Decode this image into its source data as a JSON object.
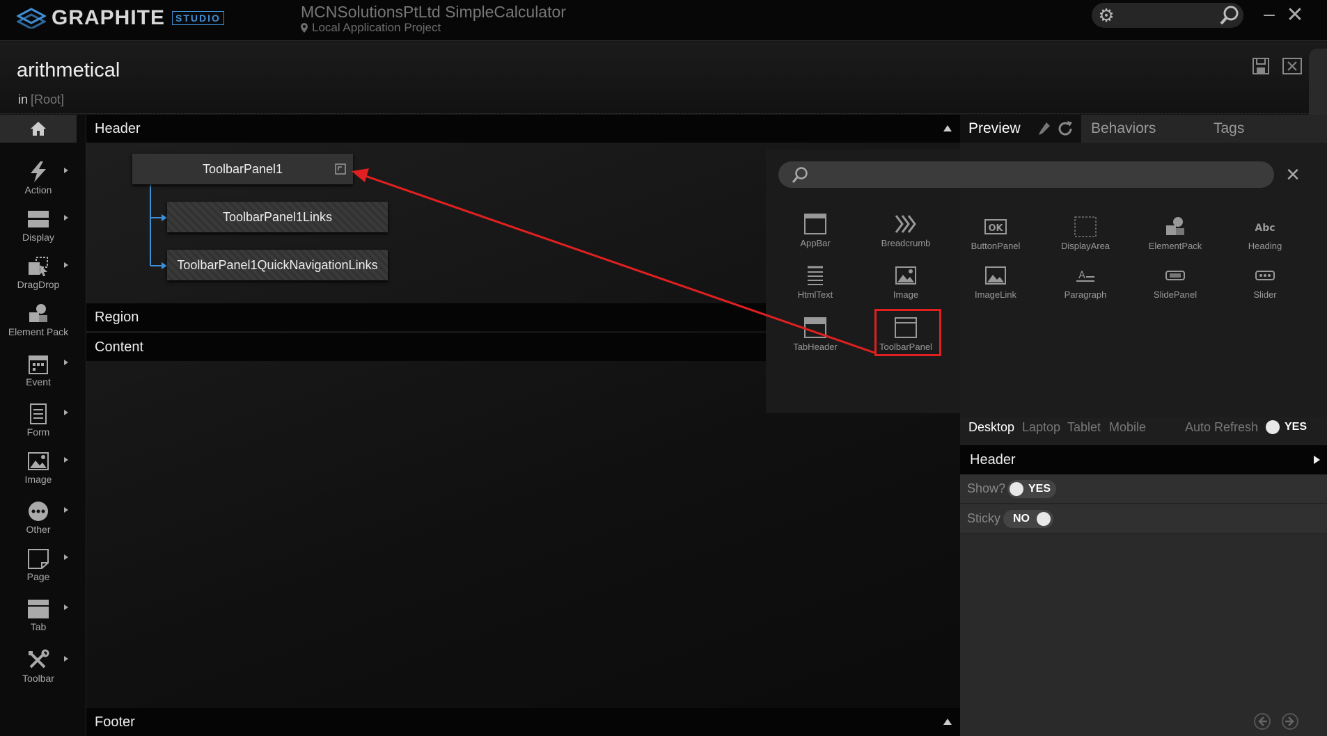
{
  "app": {
    "brand": "GRAPHITE",
    "brand_tag": "STUDIO",
    "project_name": "MCNSolutionsPtLtd SimpleCalculator",
    "project_type": "Local Application Project",
    "accent": "#3f8fd6"
  },
  "page": {
    "title": "arithmetical",
    "path_prefix": "in",
    "path_root": "[Root]"
  },
  "sidebar": {
    "items": [
      {
        "label": "Action",
        "icon": "lightning-icon"
      },
      {
        "label": "Display",
        "icon": "display-icon"
      },
      {
        "label": "DragDrop",
        "icon": "dragdrop-icon"
      },
      {
        "label": "Element Pack",
        "icon": "element-pack-icon"
      },
      {
        "label": "Event",
        "icon": "calendar-icon"
      },
      {
        "label": "Form",
        "icon": "form-icon"
      },
      {
        "label": "Image",
        "icon": "image-icon"
      },
      {
        "label": "Other",
        "icon": "more-icon"
      },
      {
        "label": "Page",
        "icon": "page-icon"
      },
      {
        "label": "Tab",
        "icon": "tab-icon"
      },
      {
        "label": "Toolbar",
        "icon": "tools-icon"
      }
    ]
  },
  "canvas": {
    "sections": {
      "header": "Header",
      "region": "Region",
      "content": "Content",
      "footer": "Footer"
    },
    "nodes": {
      "root": "ToolbarPanel1",
      "child1": "ToolbarPanel1Links",
      "child2": "ToolbarPanel1QuickNavigationLinks"
    }
  },
  "picker": {
    "components": [
      "AppBar",
      "Breadcrumb",
      "HtmlText",
      "Image",
      "TabHeader",
      "ToolbarPanel",
      "ButtonPanel",
      "DisplayArea",
      "ElementPack",
      "Heading",
      "ImageLink",
      "Paragraph",
      "SlidePanel",
      "Slider"
    ],
    "highlight_color": "#e02020"
  },
  "right_panel": {
    "tabs": {
      "preview": "Preview",
      "behaviors": "Behaviors",
      "tags": "Tags"
    },
    "devices": {
      "desktop": "Desktop",
      "laptop": "Laptop",
      "tablet": "Tablet",
      "mobile": "Mobile"
    },
    "auto_refresh_label": "Auto Refresh",
    "auto_refresh_value": "YES",
    "section_title": "Header",
    "props": {
      "show_label": "Show?",
      "show_value": "YES",
      "sticky_label": "Sticky",
      "sticky_value": "NO"
    }
  }
}
